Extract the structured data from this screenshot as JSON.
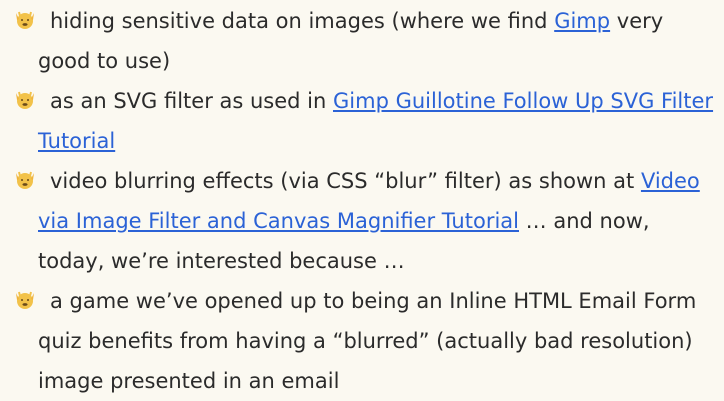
{
  "items": [
    {
      "icon": "hands-raised-emoji",
      "parts": [
        {
          "text": "hiding sensitive data on images (where we find "
        },
        {
          "link": "Gimp"
        },
        {
          "text": " very good to use)"
        }
      ]
    },
    {
      "icon": "hands-raised-emoji",
      "parts": [
        {
          "text": "as an SVG filter as used in "
        },
        {
          "link": "Gimp Guillotine Follow Up SVG Filter Tutorial"
        }
      ]
    },
    {
      "icon": "hands-raised-emoji",
      "parts": [
        {
          "text": "video blurring effects (via CSS “blur” filter) as shown at "
        },
        {
          "link": "Video via Image Filter and Canvas Magnifier Tutorial"
        },
        {
          "text": " … and now, today, we’re interested because …"
        }
      ]
    },
    {
      "icon": "hands-raised-emoji",
      "parts": [
        {
          "text": "a game we’ve opened up to being an Inline HTML Email Form quiz benefits from having a “blurred” (actually bad resolution) image presented in an email"
        }
      ]
    }
  ],
  "colors": {
    "background": "#fbf9f1",
    "text": "#2b2b2b",
    "link": "#2b62d6",
    "emoji": "#f2c24a"
  }
}
